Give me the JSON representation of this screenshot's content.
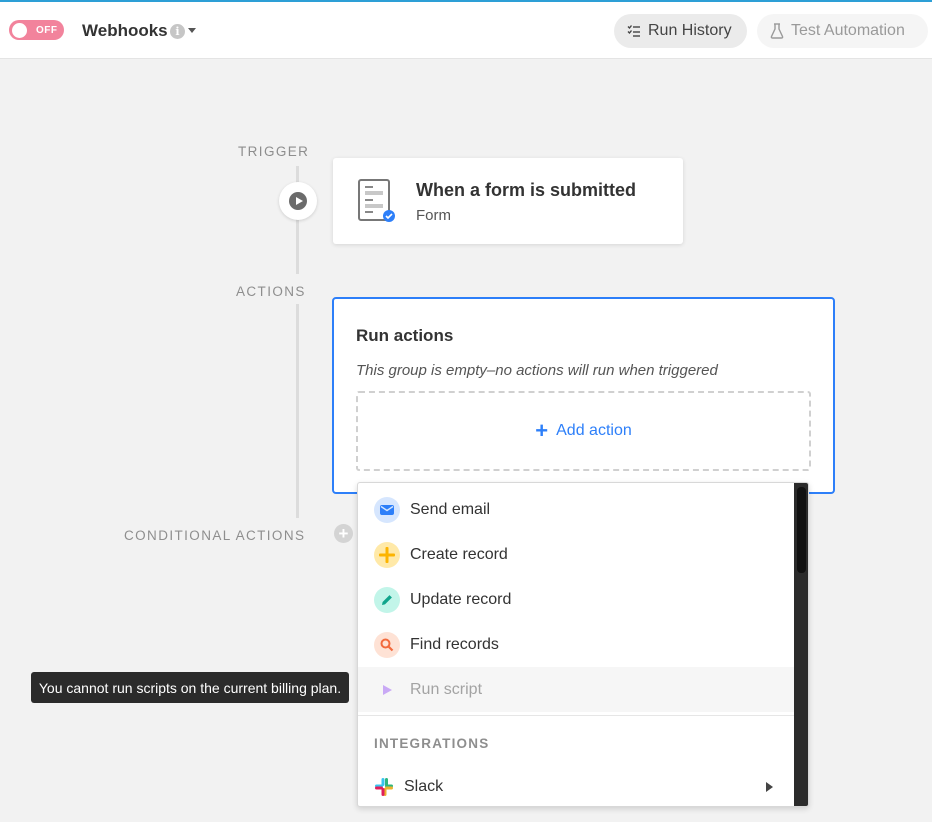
{
  "header": {
    "toggle_label": "OFF",
    "title": "Webhooks",
    "info_glyph": "i",
    "run_history_label": "Run History",
    "test_automation_label": "Test Automation"
  },
  "sections": {
    "trigger": "TRIGGER",
    "actions": "ACTIONS",
    "conditional": "CONDITIONAL ACTIONS"
  },
  "trigger_card": {
    "title": "When a form is submitted",
    "subtitle": "Form",
    "icon": "form-icon"
  },
  "actions_card": {
    "title": "Run actions",
    "empty_message": "This group is empty–no actions will run when triggered",
    "add_action_label": "Add action"
  },
  "dropdown": {
    "items": [
      {
        "label": "Send email",
        "icon": "envelope-icon",
        "color": "#2d7ff9",
        "disabled": false
      },
      {
        "label": "Create record",
        "icon": "plus-icon",
        "color": "#fcb400",
        "disabled": false
      },
      {
        "label": "Update record",
        "icon": "pencil-icon",
        "color": "#20c9a6",
        "disabled": false
      },
      {
        "label": "Find records",
        "icon": "magnifier-icon",
        "color": "#f26a3d",
        "disabled": false
      },
      {
        "label": "Run script",
        "icon": "play-icon",
        "color": "#c9a9f5",
        "disabled": true
      }
    ],
    "integrations_label": "INTEGRATIONS",
    "slack_label": "Slack"
  },
  "tooltip": "You cannot run scripts on the current billing plan.",
  "colors": {
    "accent": "#2d7ff9",
    "toggle_off": "#f2839c",
    "top_border": "#2d9fd6"
  }
}
